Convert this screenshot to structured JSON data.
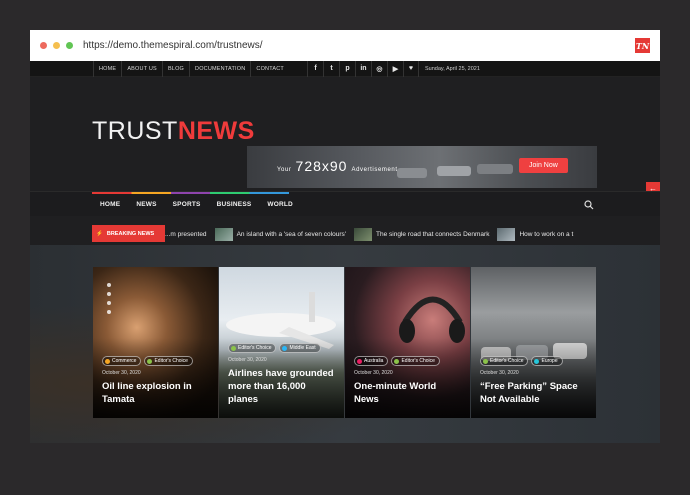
{
  "browser": {
    "url": "https://demo.themespiral.com/trustnews/",
    "badge": "TN",
    "dot_colors": [
      "#ed6a5e",
      "#f5bf4f",
      "#61c554"
    ]
  },
  "topbar": {
    "nav": [
      "HOME",
      "ABOUT US",
      "BLOG",
      "DOCUMENTATION",
      "CONTACT"
    ],
    "social": [
      {
        "icon": "facebook-icon",
        "glyph": "f"
      },
      {
        "icon": "twitter-icon",
        "glyph": "t"
      },
      {
        "icon": "pinterest-icon",
        "glyph": "p"
      },
      {
        "icon": "linkedin-icon",
        "glyph": "in"
      },
      {
        "icon": "instagram-icon",
        "glyph": "◎"
      },
      {
        "icon": "youtube-icon",
        "glyph": "▶"
      },
      {
        "icon": "heart-icon",
        "glyph": "♥"
      }
    ],
    "date": "Sunday, April 25, 2021"
  },
  "header": {
    "logo_part1": "TRUST",
    "logo_part2": "NEWS",
    "ad_your": "Your",
    "ad_size": "728x90",
    "ad_label": "Advertisement",
    "ad_button": "Join Now"
  },
  "mainnav": {
    "items": [
      "HOME",
      "NEWS",
      "SPORTS",
      "BUSINESS",
      "WORLD"
    ],
    "search_icon": "search-icon"
  },
  "ticker": {
    "label": "BREAKING NEWS",
    "items": [
      "...m presented",
      "An island with a 'sea of seven colours'",
      "The single road that connects Denmark",
      "How to work on a t"
    ]
  },
  "cards": [
    {
      "tags": [
        {
          "label": "Commerce",
          "color": "#f5a623"
        },
        {
          "label": "Editor's Choice",
          "color": "#8bc34a"
        }
      ],
      "date": "October 30, 2020",
      "title": "Oil line explosion in Tamata"
    },
    {
      "tags": [
        {
          "label": "Editor's Choice",
          "color": "#8bc34a"
        },
        {
          "label": "Middle East",
          "color": "#29b6f6"
        }
      ],
      "date": "October 30, 2020",
      "title": "Airlines have grounded more than 16,000 planes"
    },
    {
      "tags": [
        {
          "label": "Australia",
          "color": "#e91e63"
        },
        {
          "label": "Editor's Choice",
          "color": "#8bc34a"
        }
      ],
      "date": "October 30, 2020",
      "title": "One-minute World News"
    },
    {
      "tags": [
        {
          "label": "Editor's Choice",
          "color": "#8bc34a"
        },
        {
          "label": "Europe",
          "color": "#26c6da"
        }
      ],
      "date": "October 30, 2020",
      "title": "“Free Parking” Space Not Available"
    }
  ],
  "colors": {
    "accent": "#ef3b3b",
    "dark": "#1f1f21"
  }
}
